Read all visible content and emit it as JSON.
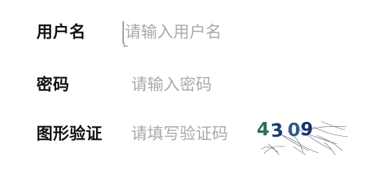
{
  "form": {
    "username": {
      "label": "用户名",
      "placeholder": "请输入用户名",
      "value": ""
    },
    "password": {
      "label": "密码",
      "placeholder": "请输入密码",
      "value": ""
    },
    "captcha": {
      "label": "图形验证",
      "placeholder": "请填写验证码",
      "value": "",
      "image_text": [
        "4",
        "3",
        "0",
        "9"
      ],
      "image_colors": [
        "#2f6b5e",
        "#1e3e6b",
        "#2e5b8f",
        "#1a2f6b"
      ]
    }
  },
  "colors": {
    "label": "#111111",
    "placeholder": "#a9a9a9",
    "background": "#ffffff"
  }
}
